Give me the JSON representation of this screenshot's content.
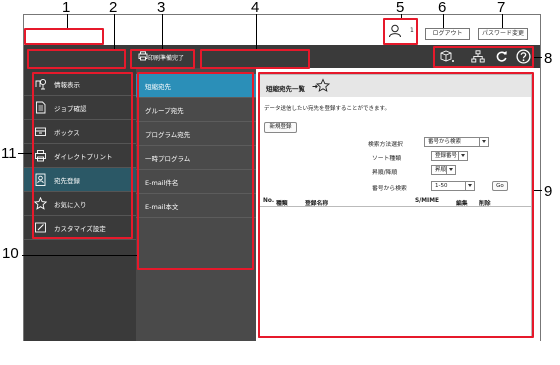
{
  "callouts": [
    "1",
    "2",
    "3",
    "4",
    "5",
    "6",
    "7",
    "8",
    "9",
    "10",
    "11"
  ],
  "header": {
    "user_count": "1",
    "logout_label": "ログアウト",
    "password_label": "パスワード変更"
  },
  "navbar": {
    "print_status": "印刷準備完了"
  },
  "left_menu": [
    {
      "label": "情報表示",
      "icon": "info-display-icon"
    },
    {
      "label": "ジョブ確認",
      "icon": "job-document-icon"
    },
    {
      "label": "ボックス",
      "icon": "box-icon"
    },
    {
      "label": "ダイレクトプリント",
      "icon": "direct-print-icon"
    },
    {
      "label": "宛先登録",
      "icon": "address-register-icon",
      "active": true
    },
    {
      "label": "お気に入り",
      "icon": "star-icon"
    },
    {
      "label": "カスタマイズ設定",
      "icon": "customize-icon"
    }
  ],
  "sub_menu": [
    {
      "label": "短縮宛先",
      "active": true
    },
    {
      "label": "グループ宛先"
    },
    {
      "label": "プログラム宛先"
    },
    {
      "label": "一時プログラム"
    },
    {
      "label": "E-mail件名"
    },
    {
      "label": "E-mail本文"
    }
  ],
  "content": {
    "title": "短縮宛先一覧",
    "description": "データ送信したい宛先を登録することができます。",
    "new_button": "新規登録",
    "search_method_label": "検索方法選択",
    "search_method_value": "番号から検索",
    "sort_type_label": "ソート種類",
    "sort_type_value": "登録番号",
    "order_label": "昇順/降順",
    "order_value": "昇順",
    "search_from_label": "番号から検索",
    "search_from_value": "1-50",
    "go_button": "Go",
    "columns": [
      "No.",
      "種類",
      "登録名称",
      "S/MIME",
      "編集",
      "削除"
    ]
  },
  "colors": {
    "callout_red": "#e6192b",
    "dark_bar": "#3a3a3a",
    "active_menu": "#2b5866",
    "active_sub": "#2b8fb8"
  }
}
